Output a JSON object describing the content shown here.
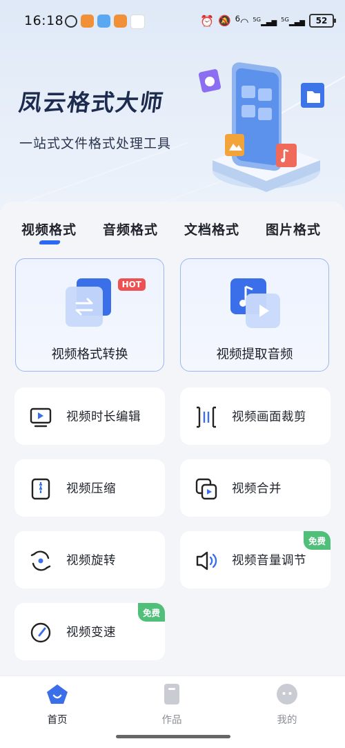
{
  "status": {
    "time": "16:18",
    "battery": "52",
    "net_left": "6",
    "net_5g_a": "5G",
    "net_5g_b": "5G"
  },
  "hero": {
    "title": "凤云格式大师",
    "subtitle": "一站式文件格式处理工具"
  },
  "tabs": [
    {
      "label": "视频格式",
      "active": true
    },
    {
      "label": "音频格式",
      "active": false
    },
    {
      "label": "文档格式",
      "active": false
    },
    {
      "label": "图片格式",
      "active": false
    }
  ],
  "featured": [
    {
      "label": "视频格式转换",
      "badge": "HOT",
      "icon": "swap-icon"
    },
    {
      "label": "视频提取音频",
      "icon": "music-extract-icon"
    }
  ],
  "tools": [
    {
      "label": "视频时长编辑",
      "icon": "monitor-play-icon"
    },
    {
      "label": "视频画面裁剪",
      "icon": "crop-bracket-icon"
    },
    {
      "label": "视频压缩",
      "icon": "zip-icon"
    },
    {
      "label": "视频合并",
      "icon": "merge-icon"
    },
    {
      "label": "视频旋转",
      "icon": "rotate-icon"
    },
    {
      "label": "视频音量调节",
      "icon": "volume-icon",
      "badge": "免费"
    },
    {
      "label": "视频变速",
      "icon": "speed-icon",
      "badge": "免费"
    }
  ],
  "nav": [
    {
      "label": "首页",
      "icon": "home-icon",
      "active": true
    },
    {
      "label": "作品",
      "icon": "works-icon",
      "active": false
    },
    {
      "label": "我的",
      "icon": "profile-icon",
      "active": false
    }
  ],
  "colors": {
    "accent": "#2e68f0",
    "hot": "#ee5151",
    "free": "#4fbf7a",
    "title": "#1c2b4e"
  }
}
